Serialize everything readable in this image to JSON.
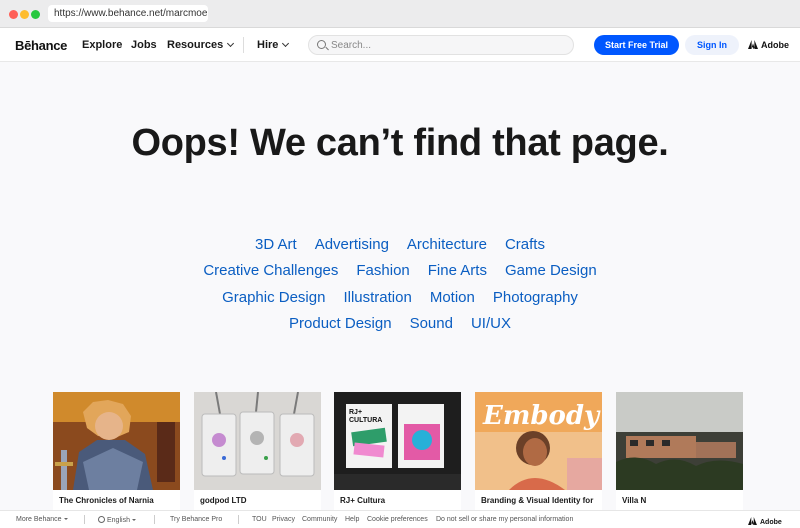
{
  "browser": {
    "url": "https://www.behance.net/marcmoeller"
  },
  "header": {
    "logo": "Bēhance",
    "nav": [
      "Explore",
      "Jobs",
      "Resources",
      "Hire"
    ],
    "search_placeholder": "Search...",
    "start_trial_label": "Start Free Trial",
    "sign_in_label": "Sign In",
    "adobe_label": "Adobe"
  },
  "main": {
    "headline": "Oops! We can’t find that page.",
    "category_rows": [
      [
        "3D Art",
        "Advertising",
        "Architecture",
        "Crafts"
      ],
      [
        "Creative Challenges",
        "Fashion",
        "Fine Arts",
        "Game Design"
      ],
      [
        "Graphic Design",
        "Illustration",
        "Motion",
        "Photography"
      ],
      [
        "Product Design",
        "Sound",
        "UI/UX"
      ]
    ]
  },
  "projects": [
    {
      "title": "The Chronicles of Narnia"
    },
    {
      "title": "godpod LTD"
    },
    {
      "title": "RJ+ Cultura",
      "thumb_text": [
        "RJ+",
        "CULTURA"
      ]
    },
    {
      "title": "Branding & Visual Identity for",
      "thumb_text": "Embody"
    },
    {
      "title": "Villa N"
    }
  ],
  "footer": {
    "more": "More Behance",
    "language": "English",
    "links": [
      "Try Behance Pro",
      "TOU",
      "Privacy",
      "Community",
      "Help",
      "Cookie preferences",
      "Do not sell or share my personal information"
    ],
    "adobe_label": "Adobe"
  },
  "colors": {
    "accent": "#0057ff",
    "category_link": "#0b5ec2",
    "background": "#f9f9fb"
  }
}
